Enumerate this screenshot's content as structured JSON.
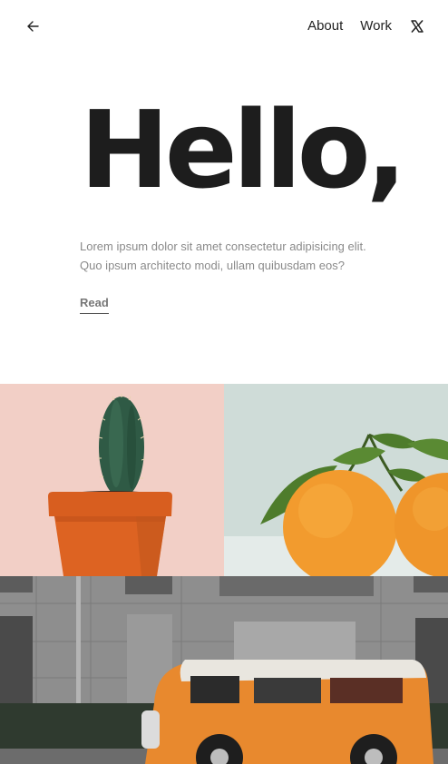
{
  "header": {
    "back_icon": "arrow-left-icon",
    "nav": [
      {
        "label": "About"
      },
      {
        "label": "Work"
      }
    ],
    "social_icon": "x-logo-icon"
  },
  "hero": {
    "title": "Hello,",
    "intro": "Lorem ipsum dolor sit amet consectetur adipisicing elit. Quo ipsum architecto modi, ullam quibusdam eos?",
    "read_link": "Read"
  },
  "gallery": {
    "images": [
      {
        "subject": "cactus-in-terracotta-pot",
        "background": "#f2cfc6"
      },
      {
        "subject": "two-oranges-with-leaves",
        "background": "#cfdcd8"
      },
      {
        "subject": "orange-vw-van-in-front-of-building",
        "background": "#8f8f8f"
      }
    ]
  },
  "colors": {
    "text_dark": "#1d1d1d",
    "text_muted": "#8a8a8a",
    "accent_orange": "#e8892e"
  }
}
